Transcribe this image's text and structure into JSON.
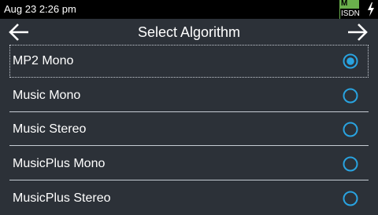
{
  "status": {
    "datetime": "Aug 23 2:26 pm",
    "isdn_badge_top": "M",
    "isdn_badge_label": "ISDN",
    "power_icon": "bolt-icon"
  },
  "header": {
    "back_icon": "arrow-left-icon",
    "title": "Select Algorithm",
    "next_icon": "arrow-right-icon"
  },
  "colors": {
    "accent": "#29a3e0",
    "background": "#2c3138",
    "status_bar": "#000000",
    "isdn_green": "#6ab04c"
  },
  "algorithms": [
    {
      "label": "MP2 Mono",
      "selected": true
    },
    {
      "label": "Music Mono",
      "selected": false
    },
    {
      "label": "Music Stereo",
      "selected": false
    },
    {
      "label": "MusicPlus Mono",
      "selected": false
    },
    {
      "label": "MusicPlus Stereo",
      "selected": false
    }
  ]
}
